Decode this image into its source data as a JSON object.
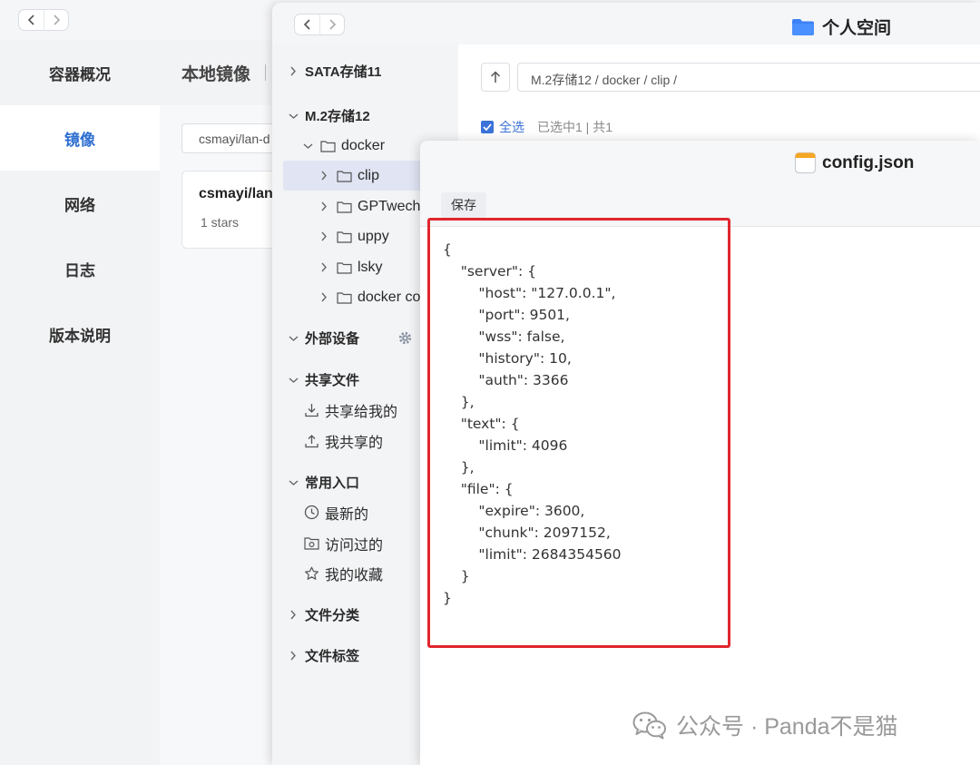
{
  "docker": {
    "page_title": "本地镜像",
    "nav_items": [
      {
        "label": "容器概况",
        "active": false
      },
      {
        "label": "镜像",
        "active": true
      },
      {
        "label": "网络",
        "active": false
      },
      {
        "label": "日志",
        "active": false
      },
      {
        "label": "版本说明",
        "active": false
      }
    ],
    "search_value": "csmayi/lan-d",
    "card": {
      "name": "csmayi/lan",
      "stars": "1 stars"
    },
    "accent_color": "#2f6fd1"
  },
  "file_manager": {
    "window_title": "个人空间",
    "path": "M.2存储12 / docker / clip /",
    "select_all_label": "全选",
    "select_info": "已选中1 | 共1",
    "tree": [
      {
        "label": "SATA存储11",
        "icon": "chevron-right-icon"
      },
      {
        "label": "M.2存储12",
        "icon": "chevron-down-icon"
      },
      {
        "label": "docker",
        "icon": "folder-icon"
      },
      {
        "label": "clip",
        "icon": "folder-icon",
        "selected": true
      },
      {
        "label": "GPTwecha",
        "icon": "folder-icon"
      },
      {
        "label": "uppy",
        "icon": "folder-icon"
      },
      {
        "label": "lsky",
        "icon": "folder-icon"
      },
      {
        "label": "docker co",
        "icon": "folder-icon"
      },
      {
        "label": "外部设备",
        "icon": "gear-icon"
      },
      {
        "label": "共享文件",
        "icon": "chevron-down-icon"
      },
      {
        "label": "共享给我的",
        "icon": "share-in-icon"
      },
      {
        "label": "我共享的",
        "icon": "share-out-icon"
      },
      {
        "label": "常用入口",
        "icon": "chevron-down-icon"
      },
      {
        "label": "最新的",
        "icon": "clock-icon"
      },
      {
        "label": "访问过的",
        "icon": "eye-icon"
      },
      {
        "label": "我的收藏",
        "icon": "star-icon"
      },
      {
        "label": "文件分类",
        "icon": "chevron-right-icon"
      },
      {
        "label": "文件标签",
        "icon": "chevron-right-icon"
      }
    ],
    "folder_color": "#3c82f6"
  },
  "editor": {
    "filename": "config.json",
    "save_label": "保存",
    "highlight_color": "#e1262d",
    "code_lines": [
      "{",
      "    \"server\": {",
      "        \"host\": \"127.0.0.1\",",
      "        \"port\": 9501,",
      "        \"wss\": false,",
      "        \"history\": 10,",
      "        \"auth\": 3366",
      "    },",
      "    \"text\": {",
      "        \"limit\": 4096",
      "    },",
      "    \"file\": {",
      "        \"expire\": 3600,",
      "        \"chunk\": 2097152,",
      "        \"limit\": 2684354560",
      "    }",
      "}"
    ]
  },
  "watermark": {
    "text": "公众号 · Panda不是猫",
    "icon": "wechat-icon"
  }
}
